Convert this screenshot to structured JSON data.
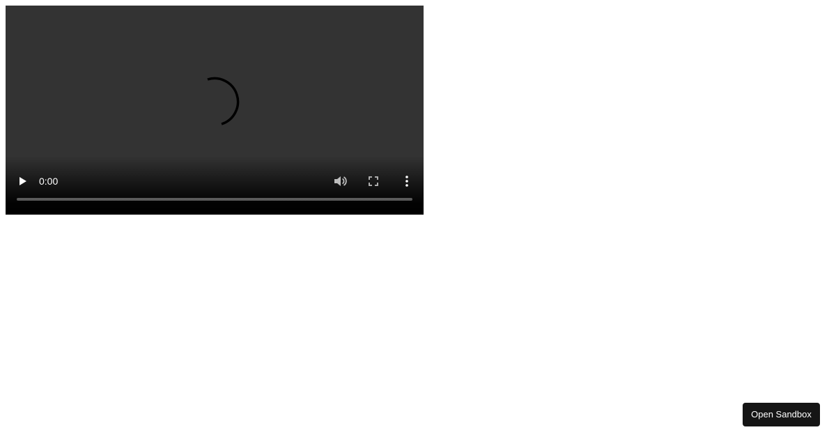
{
  "video": {
    "time": "0:00",
    "progress": 0,
    "state": "loading",
    "icons": {
      "spinner": "loading-spinner-icon",
      "play": "play-icon",
      "volume": "volume-icon",
      "fullscreen": "fullscreen-icon",
      "menu": "more-vertical-icon"
    }
  },
  "sandbox_button": {
    "label": "Open Sandbox"
  },
  "colors": {
    "video_background": "#333333",
    "control_icon": "#ffffff",
    "button_background": "#151515"
  }
}
